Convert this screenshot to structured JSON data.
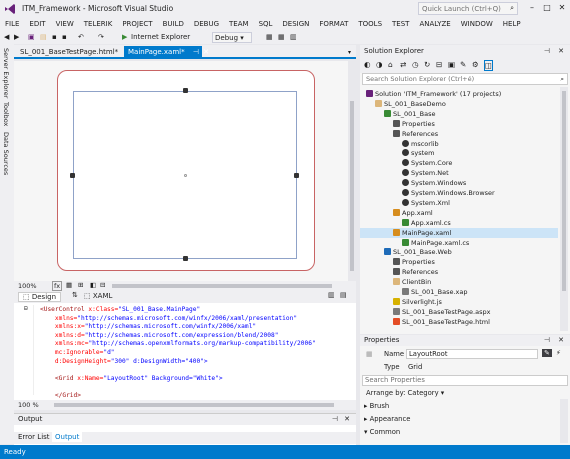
{
  "window": {
    "title": "ITM_Framework - Microsoft Visual Studio",
    "quick_launch_placeholder": "Quick Launch (Ctrl+Q)"
  },
  "menu": [
    "FILE",
    "EDIT",
    "VIEW",
    "TELERIK",
    "PROJECT",
    "BUILD",
    "DEBUG",
    "TEAM",
    "SQL",
    "DESIGN",
    "FORMAT",
    "TOOLS",
    "TEST",
    "ANALYZE",
    "WINDOW",
    "HELP"
  ],
  "toolbar": {
    "browser_label": "Internet Explorer",
    "config_label": "Debug"
  },
  "left_tabs": [
    "Server Explorer",
    "Toolbox",
    "Data Sources"
  ],
  "doc_tabs": [
    {
      "label": "SL_001_BaseTestPage.html*"
    },
    {
      "label": "MainPage.xaml*"
    }
  ],
  "zoom": {
    "designer_zoom": "100%",
    "editor_zoom": "100 %",
    "output_zoom": "100 %"
  },
  "view_tabs": {
    "design": "Design",
    "xaml": "XAML"
  },
  "xaml_lines": [
    {
      "tag": "<UserControl",
      "attr": " x:Class=",
      "val": "\"SL_001_Base.MainPage\""
    },
    {
      "tag": "",
      "attr": "    xmlns=",
      "val": "\"http://schemas.microsoft.com/winfx/2006/xaml/presentation\""
    },
    {
      "tag": "",
      "attr": "    xmlns:x=",
      "val": "\"http://schemas.microsoft.com/winfx/2006/xaml\""
    },
    {
      "tag": "",
      "attr": "    xmlns:d=",
      "val": "\"http://schemas.microsoft.com/expression/blend/2008\""
    },
    {
      "tag": "",
      "attr": "    xmlns:mc=",
      "val": "\"http://schemas.openxmlformats.org/markup-compatibility/2006\""
    },
    {
      "tag": "",
      "attr": "    mc:Ignorable=",
      "val": "\"d\""
    },
    {
      "tag": "",
      "attr": "    d:DesignHeight=",
      "val": "\"300\" d:DesignWidth=\"400\">"
    },
    {
      "tag": "",
      "attr": "",
      "val": ""
    },
    {
      "tag": "    <Grid",
      "attr": " x:Name=",
      "val": "\"LayoutRoot\" Background=\"White\">"
    },
    {
      "tag": "",
      "attr": "",
      "val": ""
    },
    {
      "tag": "    </Grid>",
      "attr": "",
      "val": ""
    }
  ],
  "output": {
    "title": "Output",
    "tabs": [
      "Error List",
      "Output"
    ]
  },
  "solution_explorer": {
    "title": "Solution Explorer",
    "search_placeholder": "Search Solution Explorer (Ctrl+é)",
    "items": [
      {
        "label": "Solution 'ITM_Framework' (17 projects)",
        "indent": 0,
        "icon": "solution"
      },
      {
        "label": "SL_001_BaseDemo",
        "indent": 1,
        "icon": "folder"
      },
      {
        "label": "SL_001_Base",
        "indent": 2,
        "icon": "project"
      },
      {
        "label": "Properties",
        "indent": 3,
        "icon": "wrench"
      },
      {
        "label": "References",
        "indent": 3,
        "icon": "refs"
      },
      {
        "label": "mscorlib",
        "indent": 4,
        "icon": "ref"
      },
      {
        "label": "system",
        "indent": 4,
        "icon": "ref"
      },
      {
        "label": "System.Core",
        "indent": 4,
        "icon": "ref"
      },
      {
        "label": "System.Net",
        "indent": 4,
        "icon": "ref"
      },
      {
        "label": "System.Windows",
        "indent": 4,
        "icon": "ref"
      },
      {
        "label": "System.Windows.Browser",
        "indent": 4,
        "icon": "ref"
      },
      {
        "label": "System.Xml",
        "indent": 4,
        "icon": "ref"
      },
      {
        "label": "App.xaml",
        "indent": 3,
        "icon": "xaml"
      },
      {
        "label": "App.xaml.cs",
        "indent": 4,
        "icon": "cs"
      },
      {
        "label": "MainPage.xaml",
        "indent": 3,
        "icon": "xaml",
        "selected": true
      },
      {
        "label": "MainPage.xaml.cs",
        "indent": 4,
        "icon": "cs"
      },
      {
        "label": "SL_001_Base.Web",
        "indent": 2,
        "icon": "web"
      },
      {
        "label": "Properties",
        "indent": 3,
        "icon": "wrench"
      },
      {
        "label": "References",
        "indent": 3,
        "icon": "refs"
      },
      {
        "label": "ClientBin",
        "indent": 3,
        "icon": "folder"
      },
      {
        "label": "SL_001_Base.xap",
        "indent": 4,
        "icon": "file"
      },
      {
        "label": "Silverlight.js",
        "indent": 3,
        "icon": "js"
      },
      {
        "label": "SL_001_BaseTestPage.aspx",
        "indent": 3,
        "icon": "file"
      },
      {
        "label": "SL_001_BaseTestPage.html",
        "indent": 3,
        "icon": "html"
      }
    ]
  },
  "properties": {
    "title": "Properties",
    "name_label": "Name",
    "name_value": "LayoutRoot",
    "type_label": "Type",
    "type_value": "Grid",
    "search_placeholder": "Search Properties",
    "arrange_label": "Arrange by: Category",
    "categories": [
      "Brush",
      "Appearance",
      "Common"
    ]
  },
  "status": {
    "text": "Ready"
  },
  "colors": {
    "accent": "#007acc",
    "selection": "#cce4f7"
  }
}
